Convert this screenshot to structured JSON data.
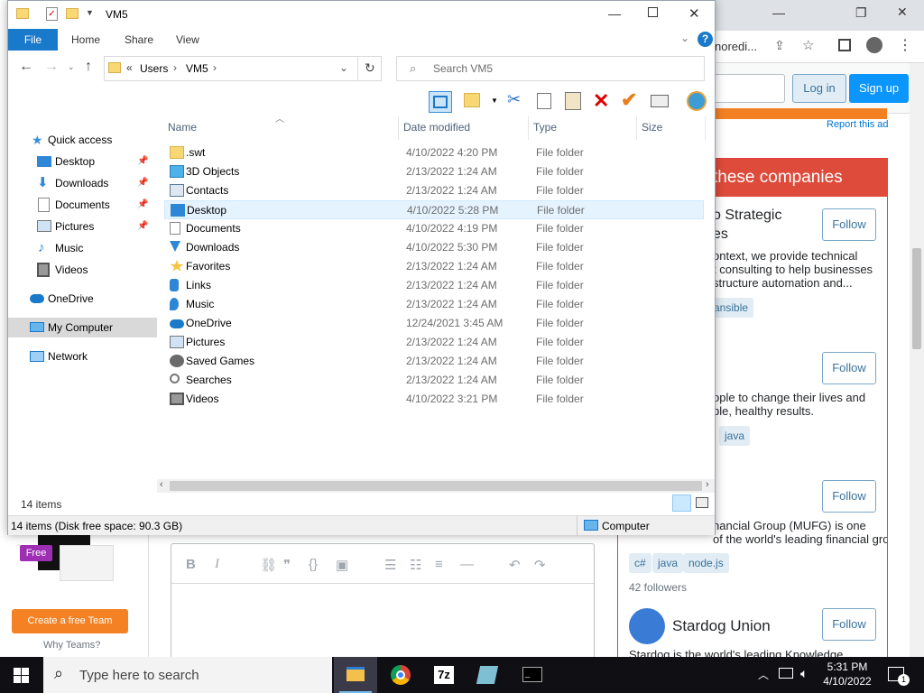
{
  "browser": {
    "address_fragment": "noredi...",
    "login_label": "Log in",
    "signup_label": "Sign up",
    "report_ad": "Report this ad",
    "companies_heading": "these companies",
    "companies": [
      {
        "title": "o Strategic",
        "title2": "es",
        "desc": "ontext, we provide technical\nt consulting to help businesses\nstructure automation and...",
        "tags": [
          "ansible"
        ],
        "follow": "Follow"
      },
      {
        "desc": "ople to change their lives and\nble, healthy results.",
        "tags": [
          "java"
        ],
        "follow": "Follow"
      },
      {
        "desc": "nancial Group (MUFG) is one\nof the world's leading financial groups.",
        "tags": [
          "c#",
          "java",
          "node.js"
        ],
        "followers": "42 followers",
        "follow": "Follow"
      },
      {
        "title": "Stardog Union",
        "desc": "Stardog is the world's leading Knowledge",
        "follow": "Follow"
      }
    ],
    "free_badge": "Free",
    "create_team": "Create a free Team",
    "why_teams": "Why Teams?"
  },
  "explorer": {
    "title": "VM5",
    "tabs": {
      "file": "File",
      "home": "Home",
      "share": "Share",
      "view": "View"
    },
    "address": {
      "prefix": "«",
      "parts": [
        "Users",
        "VM5"
      ]
    },
    "search_placeholder": "Search VM5",
    "nav": [
      {
        "label": "Quick access",
        "icon": "star-icon",
        "pinned": false
      },
      {
        "label": "Desktop",
        "icon": "desktop-icon",
        "pinned": true
      },
      {
        "label": "Downloads",
        "icon": "download-icon",
        "pinned": true
      },
      {
        "label": "Documents",
        "icon": "document-icon",
        "pinned": true
      },
      {
        "label": "Pictures",
        "icon": "pictures-icon",
        "pinned": true
      },
      {
        "label": "Music",
        "icon": "music-icon",
        "pinned": false
      },
      {
        "label": "Videos",
        "icon": "video-icon",
        "pinned": false
      },
      {
        "label": "OneDrive",
        "icon": "cloud-icon",
        "pinned": false
      },
      {
        "label": "My Computer",
        "icon": "computer-icon",
        "pinned": false
      },
      {
        "label": "Network",
        "icon": "network-icon",
        "pinned": false
      }
    ],
    "columns": {
      "name": "Name",
      "date": "Date modified",
      "type": "Type",
      "size": "Size"
    },
    "files": [
      {
        "name": ".swt",
        "date": "4/10/2022 4:20 PM",
        "type": "File folder",
        "icon": "folder-icon"
      },
      {
        "name": "3D Objects",
        "date": "2/13/2022 1:24 AM",
        "type": "File folder",
        "icon": "cube-icon"
      },
      {
        "name": "Contacts",
        "date": "2/13/2022 1:24 AM",
        "type": "File folder",
        "icon": "contacts-icon"
      },
      {
        "name": "Desktop",
        "date": "4/10/2022 5:28 PM",
        "type": "File folder",
        "icon": "desktop-icon"
      },
      {
        "name": "Documents",
        "date": "4/10/2022 4:19 PM",
        "type": "File folder",
        "icon": "document-icon"
      },
      {
        "name": "Downloads",
        "date": "4/10/2022 5:30 PM",
        "type": "File folder",
        "icon": "download-icon"
      },
      {
        "name": "Favorites",
        "date": "2/13/2022 1:24 AM",
        "type": "File folder",
        "icon": "star-icon"
      },
      {
        "name": "Links",
        "date": "2/13/2022 1:24 AM",
        "type": "File folder",
        "icon": "link-icon"
      },
      {
        "name": "Music",
        "date": "2/13/2022 1:24 AM",
        "type": "File folder",
        "icon": "music-icon"
      },
      {
        "name": "OneDrive",
        "date": "12/24/2021 3:45 AM",
        "type": "File folder",
        "icon": "cloud-icon"
      },
      {
        "name": "Pictures",
        "date": "2/13/2022 1:24 AM",
        "type": "File folder",
        "icon": "pictures-icon"
      },
      {
        "name": "Saved Games",
        "date": "2/13/2022 1:24 AM",
        "type": "File folder",
        "icon": "game-icon"
      },
      {
        "name": "Searches",
        "date": "2/13/2022 1:24 AM",
        "type": "File folder",
        "icon": "search-icon"
      },
      {
        "name": "Videos",
        "date": "4/10/2022 3:21 PM",
        "type": "File folder",
        "icon": "video-icon"
      }
    ],
    "item_count": "14 items",
    "status": "14 items (Disk free space: 90.3 GB)",
    "status_location": "Computer"
  },
  "taskbar": {
    "search_placeholder": "Type here to search",
    "time": "5:31 PM",
    "date": "4/10/2022",
    "notification_count": "1"
  },
  "colors": {
    "accent": "#1979ca",
    "selection": "#e5f3ff",
    "so_orange": "#f48024",
    "so_blue": "#0a95ff"
  }
}
